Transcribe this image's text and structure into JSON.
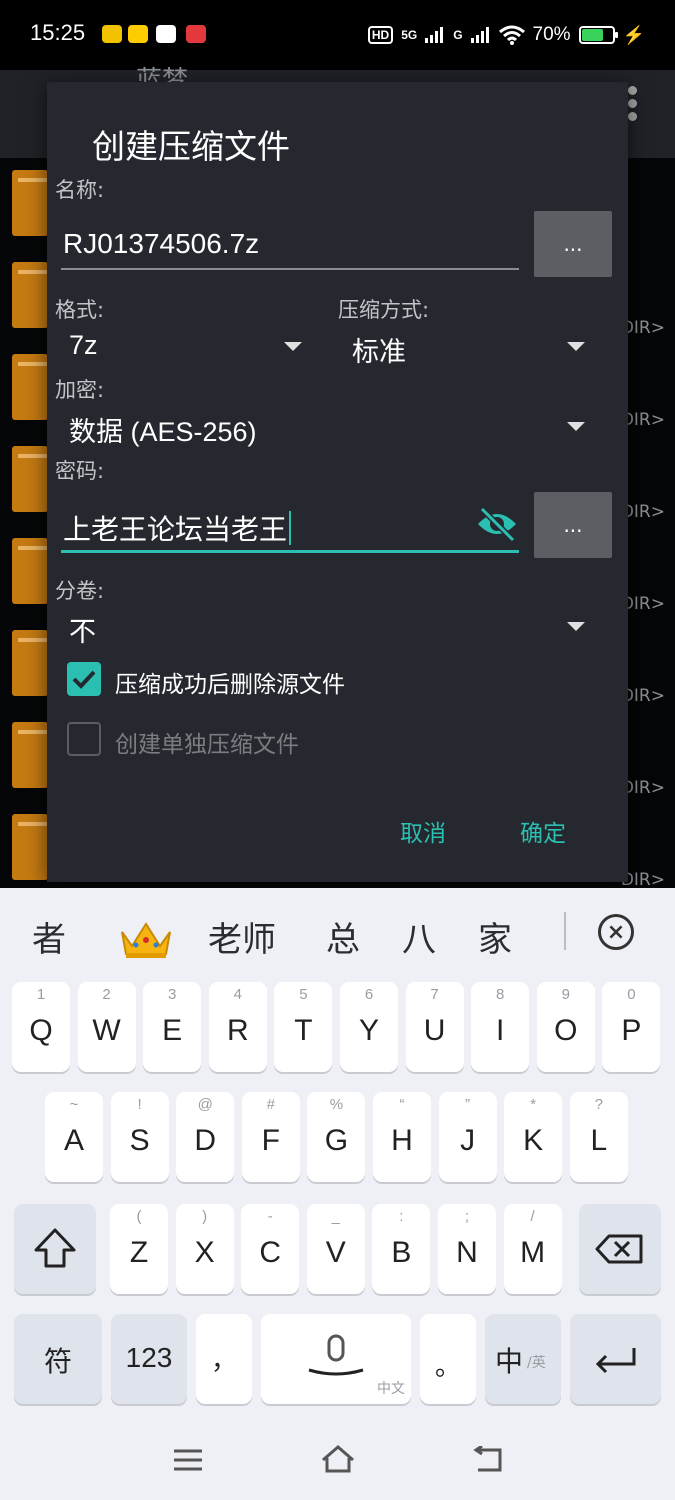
{
  "status_bar": {
    "time": "15:25",
    "network_1": "HD",
    "network_2": "5G",
    "network_3": "G",
    "battery": "70%"
  },
  "background_app": {
    "title": "蓝梦",
    "dir_label": "DIR>"
  },
  "dialog": {
    "title": "创建压缩文件",
    "name_label": "名称:",
    "name_value": "RJ01374506.7z",
    "browse_button": "...",
    "format_label": "格式:",
    "format_value": "7z",
    "method_label": "压缩方式:",
    "method_value": "标准",
    "encryption_label": "加密:",
    "encryption_value": "数据 (AES-256)",
    "password_label": "密码:",
    "password_value": "上老王论坛当老王",
    "password_button": "...",
    "split_label": "分卷:",
    "split_value": "不",
    "delete_source_label": "压缩成功后删除源文件",
    "delete_source_checked": true,
    "separate_archives_label": "创建单独压缩文件",
    "separate_archives_checked": false,
    "cancel_button": "取消",
    "ok_button": "确定"
  },
  "keyboard": {
    "candidates": [
      "者",
      "老师",
      "总",
      "八",
      "家"
    ],
    "row1": [
      {
        "key": "Q",
        "hint": "1"
      },
      {
        "key": "W",
        "hint": "2"
      },
      {
        "key": "E",
        "hint": "3"
      },
      {
        "key": "R",
        "hint": "4"
      },
      {
        "key": "T",
        "hint": "5"
      },
      {
        "key": "Y",
        "hint": "6"
      },
      {
        "key": "U",
        "hint": "7"
      },
      {
        "key": "I",
        "hint": "8"
      },
      {
        "key": "O",
        "hint": "9"
      },
      {
        "key": "P",
        "hint": "0"
      }
    ],
    "row2": [
      {
        "key": "A",
        "hint": "~"
      },
      {
        "key": "S",
        "hint": "!"
      },
      {
        "key": "D",
        "hint": "@"
      },
      {
        "key": "F",
        "hint": "#"
      },
      {
        "key": "G",
        "hint": "%"
      },
      {
        "key": "H",
        "hint": "“"
      },
      {
        "key": "J",
        "hint": "”"
      },
      {
        "key": "K",
        "hint": "*"
      },
      {
        "key": "L",
        "hint": "?"
      }
    ],
    "row3": [
      {
        "key": "Z",
        "hint": "("
      },
      {
        "key": "X",
        "hint": ")"
      },
      {
        "key": "C",
        "hint": "-"
      },
      {
        "key": "V",
        "hint": "_"
      },
      {
        "key": "B",
        "hint": ":"
      },
      {
        "key": "N",
        "hint": ";"
      },
      {
        "key": "M",
        "hint": "/"
      }
    ],
    "symbols_key": "符",
    "numbers_key": "123",
    "comma_key": "，",
    "space_hint": "中文",
    "period_key": "。",
    "lang_key": "中",
    "lang_alt": "/英"
  }
}
